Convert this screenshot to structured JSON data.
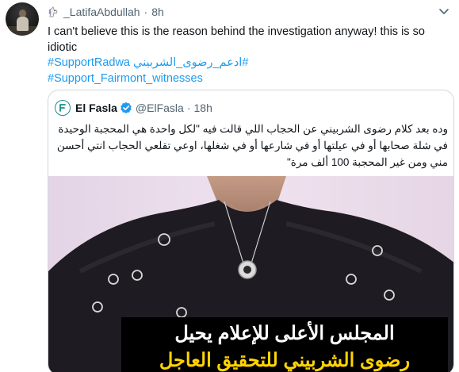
{
  "tweet": {
    "display_name": "_LatifaAbdullah",
    "time": "8h",
    "separator": "·",
    "text": "I can't believe this is the reason behind the investigation anyway! this is so idiotic",
    "hashtags": {
      "en1": "#SupportRadwa",
      "ar1": "#ادعم_رضوى_الشربيني",
      "en2": "#Support_Fairmont_witnesses"
    }
  },
  "quote": {
    "name": "El Fasla",
    "handle": "@ElFasla",
    "separator": "·",
    "time": "18h",
    "text": "وده بعد كلام رضوى الشربيني عن الحجاب اللي قالت فيه \"لكل واحدة هي المحجبة الوحيدة في شلة صحابها أو في عيلتها أو في شارعها أو في شغلها، اوعي تقلعي الحجاب انتي أحسن مني ومن غير المحجبة 100 ألف مرة\"",
    "media": {
      "caption_line1": "المجلس الأعلى للإعلام يحيل",
      "caption_line2": "رضوى الشربيني للتحقيق العاجل"
    }
  },
  "icons": {
    "avatar": "profile-photo",
    "unicorn": "unicorn-emoji",
    "chevron": "chevron-down-icon",
    "verified": "verified-badge-icon",
    "logo": "el-fasla-logo"
  },
  "colors": {
    "link": "#1d9bf0",
    "secondary_text": "#536471",
    "border": "#cfd9de",
    "caption_highlight": "#ffd400",
    "verified": "#1d9bf0"
  }
}
